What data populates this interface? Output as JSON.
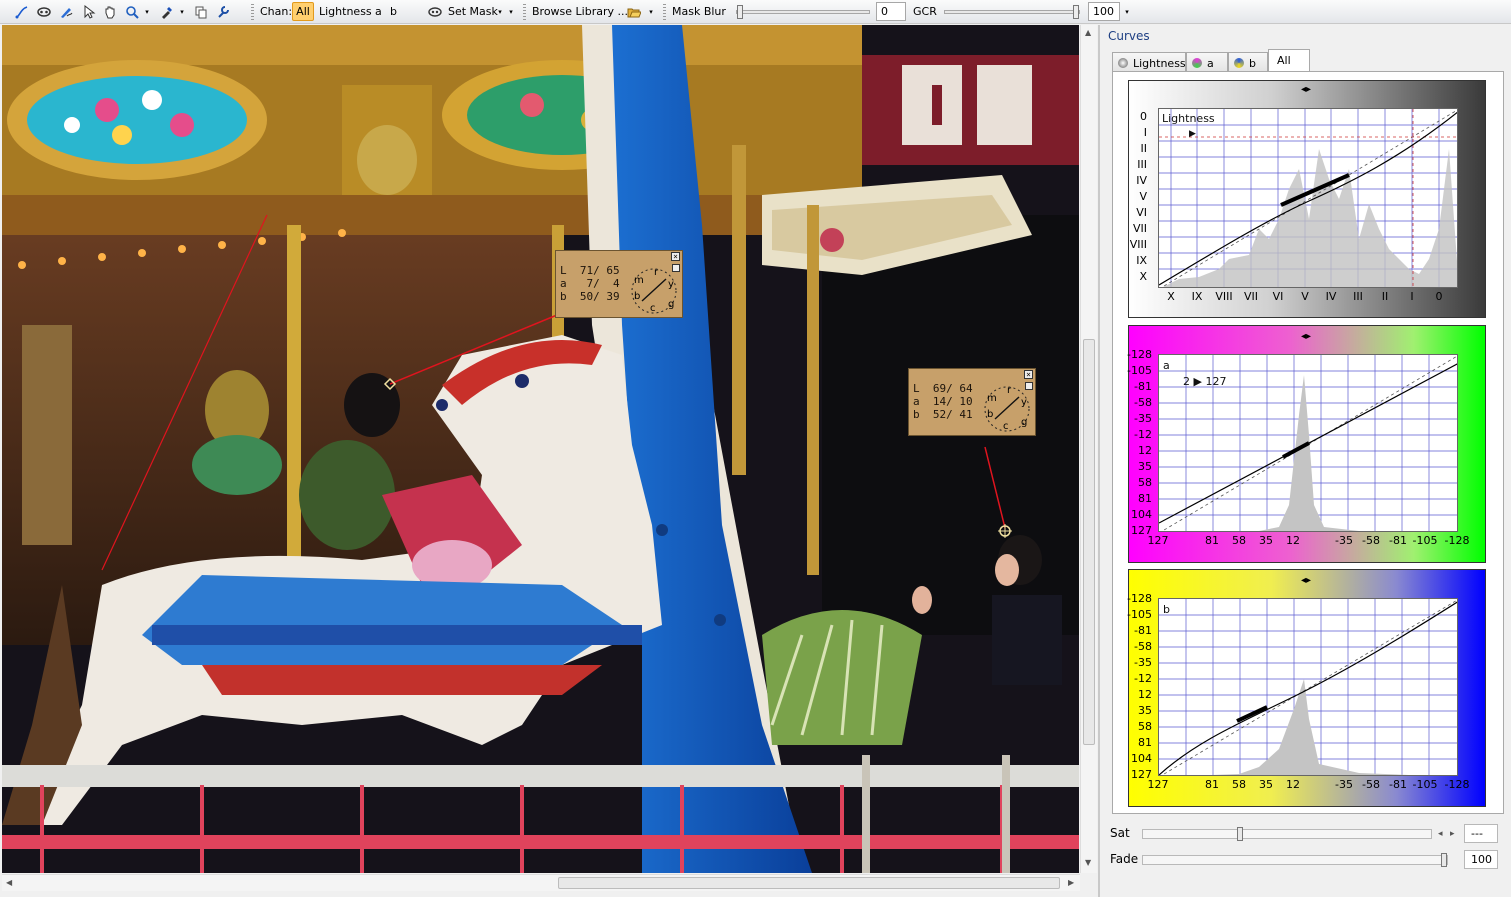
{
  "toolbar": {
    "chan_label": "Chan:",
    "chan_all": "All",
    "chan_lightness": "Lightness",
    "chan_a": "a",
    "chan_b": "b",
    "set_mask": "Set Mask",
    "browse_library": "Browse Library ...",
    "mask_blur_label": "Mask Blur",
    "mask_blur_value": "0",
    "gcr_label": "GCR",
    "gcr_value": "100"
  },
  "samplers": [
    {
      "rows": "L  71/ 65\na   7/  4\nb  50/ 39"
    },
    {
      "rows": "L  69/ 64\na  14/ 10\nb  52/ 41"
    }
  ],
  "dial_letters": {
    "m": "m",
    "r": "r",
    "y": "y",
    "b": "b",
    "c": "c",
    "g": "g"
  },
  "panel": {
    "title": "Curves",
    "tabs": [
      "Lightness",
      "a",
      "b",
      "All"
    ],
    "active_tab": "All",
    "lightness_curve": {
      "name": "Lightness",
      "y_ticks": [
        "0",
        "I",
        "II",
        "III",
        "IV",
        "V",
        "VI",
        "VII",
        "VIII",
        "IX",
        "X"
      ],
      "x_ticks": [
        "X",
        "IX",
        "VIII",
        "VII",
        "VI",
        "V",
        "IV",
        "III",
        "II",
        "I",
        "0"
      ]
    },
    "a_curve": {
      "name": "a",
      "point_readout": "2 ▶ 127",
      "y_ticks": [
        "-128",
        "-105",
        "-81",
        "-58",
        "-35",
        "-12",
        "12",
        "35",
        "58",
        "81",
        "104",
        "127"
      ],
      "x_ticks": [
        "127",
        "81",
        "58",
        "35",
        "12",
        "-35",
        "-58",
        "-81",
        "-105",
        "-128"
      ]
    },
    "b_curve": {
      "name": "b",
      "y_ticks": [
        "-128",
        "-105",
        "-81",
        "-58",
        "-35",
        "-12",
        "12",
        "35",
        "58",
        "81",
        "104",
        "127"
      ],
      "x_ticks": [
        "127",
        "81",
        "58",
        "35",
        "12",
        "-35",
        "-58",
        "-81",
        "-105",
        "-128"
      ]
    },
    "sat_label": "Sat",
    "sat_value": "---",
    "fade_label": "Fade",
    "fade_value": "100"
  },
  "colors": {
    "a_gradient_left": "#ff00ff",
    "a_gradient_right": "#00ff00",
    "b_gradient_left": "#ffff00",
    "b_gradient_right": "#0000ff",
    "grid": "#5555cc",
    "sampler_line": "#e0141e"
  }
}
